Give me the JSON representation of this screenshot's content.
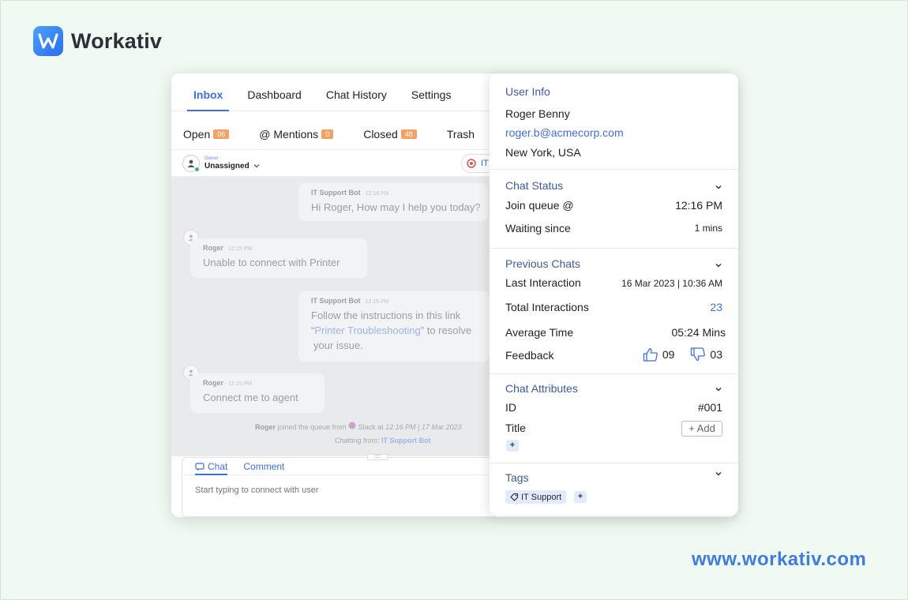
{
  "brand": {
    "name": "Workativ",
    "url": "www.workativ.com"
  },
  "nav": {
    "tabs": [
      "Inbox",
      "Dashboard",
      "Chat History",
      "Settings"
    ]
  },
  "inbox_tabs": [
    {
      "label": "Open",
      "count": "06"
    },
    {
      "label": "@ Mentions",
      "count": "0"
    },
    {
      "label": "Closed",
      "count": "48"
    },
    {
      "label": "Trash",
      "count": ""
    }
  ],
  "owner": {
    "label": "Owner",
    "value": "Unassigned"
  },
  "bot_pill": {
    "label": "IT"
  },
  "messages": [
    {
      "sender": "IT Support Bot",
      "time": "12:14 PM",
      "text": "Hi Roger, How may I help you today?"
    },
    {
      "sender": "Roger",
      "time": "12:15 PM",
      "text": "Unable to connect with Printer"
    },
    {
      "sender": "IT Support Bot",
      "time": "12:15 PM",
      "text_pre": "Follow the instructions in this link",
      "quote_open": "“",
      "link": "Printer Troubleshooting",
      "text_post": "” to resolve",
      "text_end": "your issue."
    },
    {
      "sender": "Roger",
      "time": "12:15 PM",
      "text": "Connect me to agent"
    }
  ],
  "system": {
    "user": "Roger",
    "joined_text": "joined the queue from",
    "channel": "Slack at",
    "timestamp": "12:16 PM | 17 Mar 2023",
    "chatting_from_label": "Chatting from:",
    "chatting_from_value": "IT Support Bot"
  },
  "composer": {
    "tabs": [
      "Chat",
      "Comment"
    ],
    "placeholder": "Start typing to connect with user",
    "grip": "::::::"
  },
  "user_info": {
    "title": "User Info",
    "name": "Roger Benny",
    "email": "roger.b@acmecorp.com",
    "location": "New York, USA"
  },
  "chat_status": {
    "title": "Chat Status",
    "join_queue_label": "Join queue @",
    "join_queue_value": "12:16 PM",
    "waiting_label": "Waiting since",
    "waiting_value": "1 mins"
  },
  "previous_chats": {
    "title": "Previous Chats",
    "last_label": "Last Interaction",
    "last_value": "16 Mar 2023 | 10:36 AM",
    "total_label": "Total Interactions",
    "total_value": "23",
    "avg_label": "Average Time",
    "avg_value": "05:24 Mins",
    "feedback_label": "Feedback",
    "thumbs_up": "09",
    "thumbs_down": "03"
  },
  "chat_attributes": {
    "title": "Chat Attributes",
    "id_label": "ID",
    "id_value": "#001",
    "title_label": "Title",
    "add_label": "+ Add",
    "plus": "+"
  },
  "tags": {
    "title": "Tags",
    "items": [
      "IT Support"
    ],
    "plus": "+"
  },
  "colors": {
    "accent": "#3f6ee0",
    "badge": "#f4a261",
    "background": "#f0faf2"
  }
}
